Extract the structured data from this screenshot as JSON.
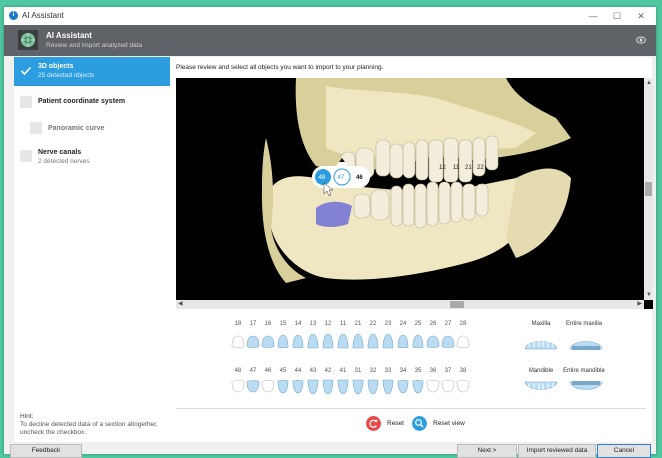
{
  "window": {
    "title": "AI Assistant",
    "minimize": "—",
    "maximize": "☐",
    "close": "✕"
  },
  "header": {
    "title": "AI Assistant",
    "subtitle": "Review and import analyzed data"
  },
  "sidebar": {
    "items": [
      {
        "label": "3D objects",
        "sub": "25 detected objects",
        "selected": true,
        "checked": true
      },
      {
        "label": "Patient coordinate system",
        "sub": "",
        "selected": false,
        "checked": false
      },
      {
        "label": "Panoramic curve",
        "sub": "",
        "selected": false,
        "checked": false
      },
      {
        "label": "Nerve canals",
        "sub": "2 detected nerves",
        "selected": false,
        "checked": false
      }
    ],
    "hint_title": "Hint:",
    "hint_text": "To decline detected data of a section altogether, uncheck the checkbox."
  },
  "main": {
    "instruction": "Please review and select all objects you want to import to your planning.",
    "popup": {
      "left": "48",
      "center": "47",
      "right": "46"
    },
    "scan_labels": [
      "12",
      "11",
      "21",
      "22"
    ],
    "upper_teeth": [
      "18",
      "17",
      "16",
      "15",
      "14",
      "13",
      "12",
      "11",
      "21",
      "22",
      "23",
      "24",
      "25",
      "26",
      "27",
      "28"
    ],
    "lower_teeth": [
      "48",
      "47",
      "46",
      "45",
      "44",
      "43",
      "42",
      "41",
      "31",
      "32",
      "33",
      "34",
      "35",
      "36",
      "37",
      "38"
    ],
    "maxilla_label": "Maxilla",
    "entire_maxilla_label": "Entire maxilla",
    "mandible_label": "Mandible",
    "entire_mandible_label": "Entire mandible",
    "reset_label": "Reset",
    "reset_view_label": "Reset view"
  },
  "footer": {
    "feedback": "Feedback",
    "next": "Next >",
    "import": "Import reviewed data",
    "cancel": "Cancel"
  },
  "colors": {
    "accent": "#2c9ee0",
    "header": "#5f6266",
    "reset": "#e84848",
    "bone": "#efe7c2",
    "selected_tooth": "#b9dcf3"
  }
}
